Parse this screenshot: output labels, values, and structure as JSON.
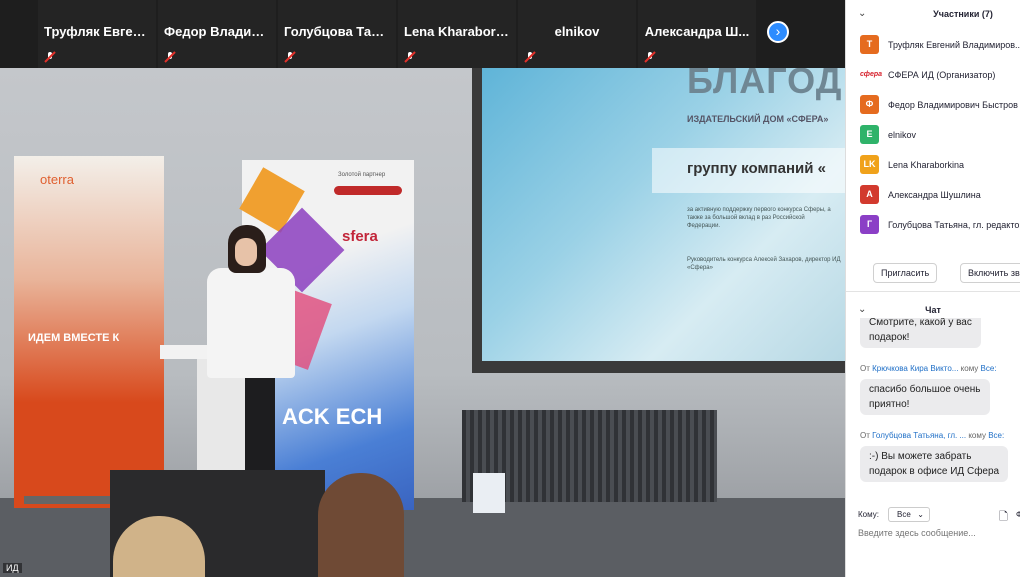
{
  "strip": {
    "tiles": [
      {
        "name": "Труфляк Евген..."
      },
      {
        "name": "Федор Владим..."
      },
      {
        "name": "Голубцова Тать..."
      },
      {
        "name": "Lena Kharabork..."
      },
      {
        "name": "elnikov"
      },
      {
        "name": "Александра Ш..."
      }
    ],
    "next_icon": "chevron-right"
  },
  "video": {
    "slide_big": "БЛАГОД",
    "slide_publisher": "ИЗДАТЕЛЬСКИЙ ДОМ «СФЕРА»",
    "slide_group": "группу компаний «",
    "slide_small": "за активную поддержку первого конкурса Сферы, а также за большой вклад в раз Российской Федерации.",
    "slide_sign": "Руководитель конкурса Алексей Захаров, директор ИД «Сфера»",
    "banner_left_logo": "oterra",
    "banner_left_text": "ИДЕМ ВМЕСТЕ К",
    "banner_right_sponsor": "Золотой партнер",
    "banner_right_org": "sfera",
    "banner_right_big": "ACK ECH",
    "label": "ИД"
  },
  "participants": {
    "title": "Участники (7)",
    "list": [
      {
        "initial": "Т",
        "color": "#e56b1f",
        "name": "Труфляк Евгений Владимиров..."
      },
      {
        "initial": "сфера",
        "color": "#d61e2a",
        "name": "СФЕРА ИД (Организатор)",
        "logo": true
      },
      {
        "initial": "Ф",
        "color": "#e56b1f",
        "name": "Федор Владимирович Быстров"
      },
      {
        "initial": "E",
        "color": "#2fb36a",
        "name": "elnikov"
      },
      {
        "initial": "LK",
        "color": "#f0a21b",
        "name": "Lena Kharaborkina"
      },
      {
        "initial": "А",
        "color": "#d23a2e",
        "name": "Александра Шушлина"
      },
      {
        "initial": "Г",
        "color": "#8b3fc6",
        "name": "Голубцова Татьяна, гл. редактор"
      }
    ],
    "invite_label": "Пригласить",
    "enable_label": "Включить зво"
  },
  "chat": {
    "title": "Чат",
    "messages": [
      {
        "text_line1": "Смотрите, какой у вас",
        "text_line2": "подарок!"
      },
      {
        "from_prefix": "От",
        "from": "Крючкова Кира Викто...",
        "to_prefix": "кому",
        "to": "Все:",
        "text_line1": "спасибо большое очень",
        "text_line2": "приятно!"
      },
      {
        "from_prefix": "От",
        "from": "Голубцова Татьяна, гл. ...",
        "to_prefix": "кому",
        "to": "Все:",
        "text_line1": ":-) Вы можете забрать",
        "text_line2": "подарок в офисе ИД Сфера"
      }
    ],
    "to_label": "Кому:",
    "to_value": "Все",
    "more_label": "Ф",
    "input_placeholder": "Введите здесь сообщение..."
  }
}
